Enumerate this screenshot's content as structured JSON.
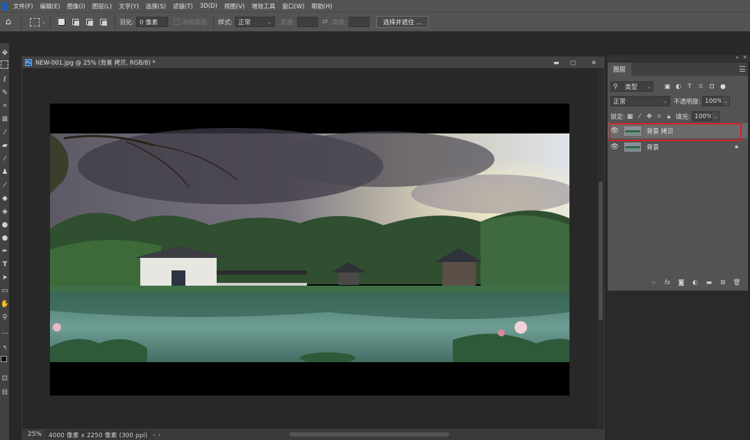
{
  "menu": [
    "文件(F)",
    "编辑(E)",
    "图像(I)",
    "图层(L)",
    "文字(Y)",
    "选择(S)",
    "滤镜(T)",
    "3D(D)",
    "视图(V)",
    "增效工具",
    "窗口(W)",
    "帮助(H)"
  ],
  "options": {
    "feather_label": "羽化:",
    "feather_value": "0 像素",
    "antialias_label": "消除锯齿",
    "style_label": "样式:",
    "style_value": "正常",
    "width_label": "宽度:",
    "height_label": "高度:",
    "select_mask_button": "选择并遮住 ..."
  },
  "document": {
    "title": "NEW-001.jpg @ 25% (背景 拷贝, RGB/8) *",
    "file_icon": "Ps",
    "zoom": "25%",
    "info": "4000 像素 x 2250 像素 (300 ppi)"
  },
  "layers_panel": {
    "tab": "图层",
    "filter_kind": "类型",
    "blend_mode": "正常",
    "opacity_label": "不透明度:",
    "opacity_value": "100%",
    "lock_label": "锁定:",
    "fill_label": "填充:",
    "fill_value": "100%",
    "layers": [
      {
        "name": "背景 拷贝",
        "selected": true,
        "locked": false
      },
      {
        "name": "背景",
        "selected": false,
        "locked": true
      }
    ]
  },
  "colors": {
    "highlight": "#d9211f",
    "ui_bg": "#535353",
    "workspace": "#282828"
  }
}
